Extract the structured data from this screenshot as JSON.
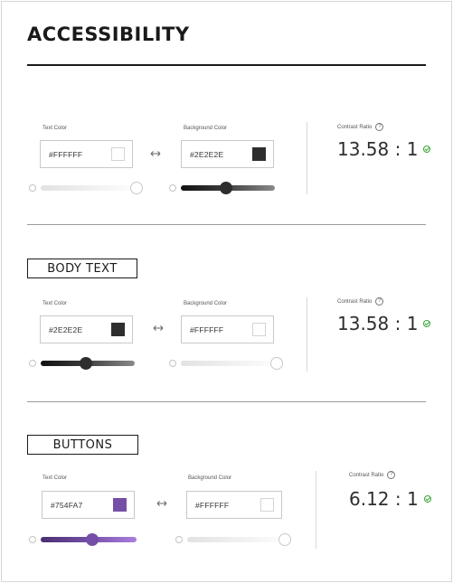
{
  "header": {
    "title": "ACCESSIBILITY"
  },
  "common": {
    "text_color_label": "Text Color",
    "background_color_label": "Background Color",
    "contrast_ratio_label": "Contrast Ratio"
  },
  "sections": [
    {
      "label": "",
      "text_color": {
        "hex": "#FFFFFF",
        "swatch": "#FFFFFF",
        "slider_level": 0.95
      },
      "background_color": {
        "hex": "#2E2E2E",
        "swatch": "#2E2E2E",
        "slider_level": 0.45
      },
      "contrast_ratio": "13.58 : 1"
    },
    {
      "label": "BODY TEXT",
      "text_color": {
        "hex": "#2E2E2E",
        "swatch": "#2E2E2E",
        "slider_level": 0.45
      },
      "background_color": {
        "hex": "#FFFFFF",
        "swatch": "#FFFFFF",
        "slider_level": 0.95
      },
      "contrast_ratio": "13.58 : 1"
    },
    {
      "label": "BUTTONS",
      "text_color": {
        "hex": "#754FA7",
        "swatch": "#754FA7",
        "slider_level": 0.5
      },
      "background_color": {
        "hex": "#FFFFFF",
        "swatch": "#FFFFFF",
        "slider_level": 0.95
      },
      "contrast_ratio": "6.12 : 1"
    }
  ],
  "colors": {
    "check": "#3AA63A",
    "purple": "#754FA7",
    "dark": "#2E2E2E"
  }
}
